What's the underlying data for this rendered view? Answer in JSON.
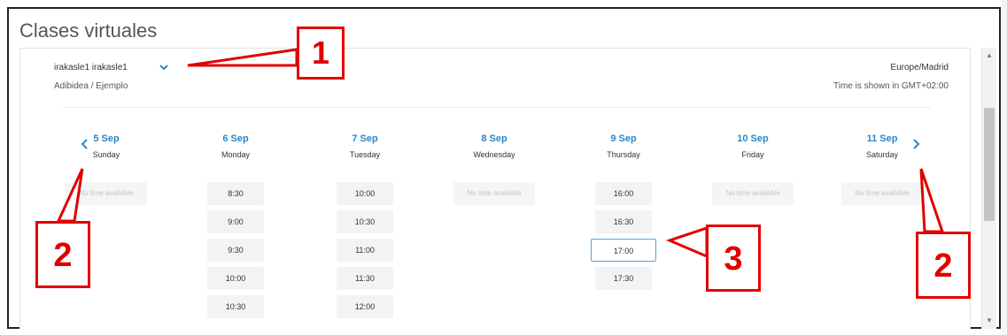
{
  "app_title": "Clases virtuales",
  "host": {
    "name": "irakasle1 irakasle1",
    "org_path": "Adibidea / Ejemplo"
  },
  "timezone": {
    "zone": "Europe/Madrid",
    "note": "Time is shown in GMT+02:00"
  },
  "calendar": {
    "days": [
      {
        "date": "5 Sep",
        "weekday": "Sunday",
        "slots": [],
        "empty_text": "No time available"
      },
      {
        "date": "6 Sep",
        "weekday": "Monday",
        "slots": [
          "8:30",
          "9:00",
          "9:30",
          "10:00",
          "10:30"
        ]
      },
      {
        "date": "7 Sep",
        "weekday": "Tuesday",
        "slots": [
          "10:00",
          "10:30",
          "11:00",
          "11:30",
          "12:00"
        ]
      },
      {
        "date": "8 Sep",
        "weekday": "Wednesday",
        "slots": [],
        "empty_text": "No time available"
      },
      {
        "date": "9 Sep",
        "weekday": "Thursday",
        "slots": [
          "16:00",
          "16:30",
          "17:00",
          "17:30"
        ],
        "selected": "17:00"
      },
      {
        "date": "10 Sep",
        "weekday": "Friday",
        "slots": [],
        "empty_text": "No time available"
      },
      {
        "date": "11 Sep",
        "weekday": "Saturday",
        "slots": [],
        "empty_text": "No time available"
      }
    ]
  },
  "callouts": {
    "c1": "1",
    "c2_left": "2",
    "c2_right": "2",
    "c3": "3"
  },
  "colors": {
    "accent": "#2a86c9",
    "callout": "#e00000"
  }
}
